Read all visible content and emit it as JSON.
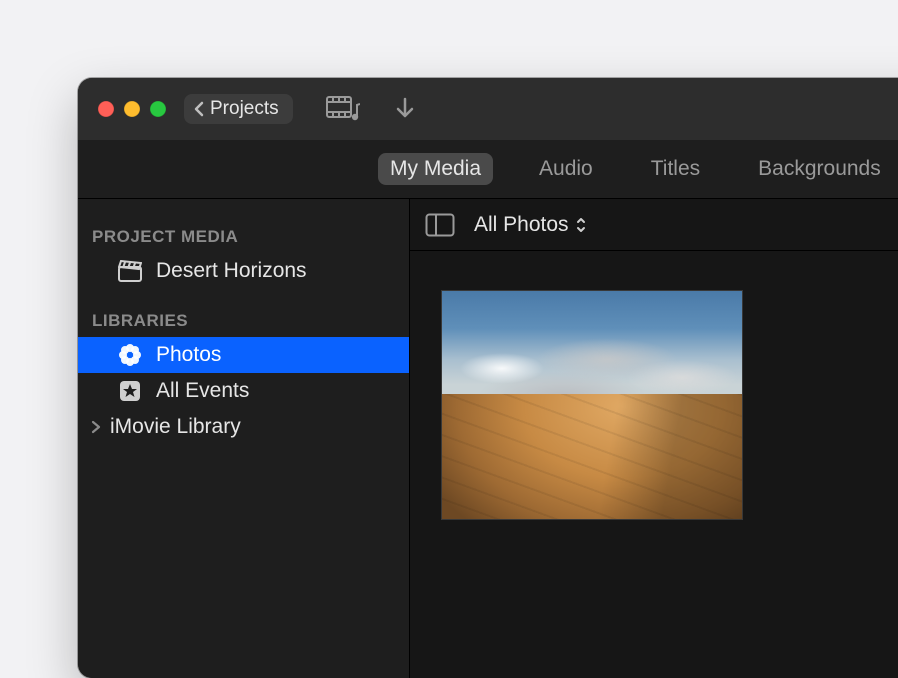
{
  "toolbar": {
    "back_label": "Projects"
  },
  "tabs": [
    {
      "label": "My Media",
      "selected": true
    },
    {
      "label": "Audio",
      "selected": false
    },
    {
      "label": "Titles",
      "selected": false
    },
    {
      "label": "Backgrounds",
      "selected": false
    }
  ],
  "sidebar": {
    "sections": [
      {
        "header": "PROJECT MEDIA",
        "items": [
          {
            "label": "Desert Horizons",
            "icon": "clapperboard-icon",
            "selected": false,
            "disclosure": false
          }
        ]
      },
      {
        "header": "LIBRARIES",
        "items": [
          {
            "label": "Photos",
            "icon": "photos-flower-icon",
            "selected": true,
            "disclosure": false
          },
          {
            "label": "All Events",
            "icon": "star-square-icon",
            "selected": false,
            "disclosure": false
          },
          {
            "label": "iMovie Library",
            "icon": null,
            "selected": false,
            "disclosure": true
          }
        ]
      }
    ]
  },
  "main": {
    "filter_label": "All Photos"
  }
}
